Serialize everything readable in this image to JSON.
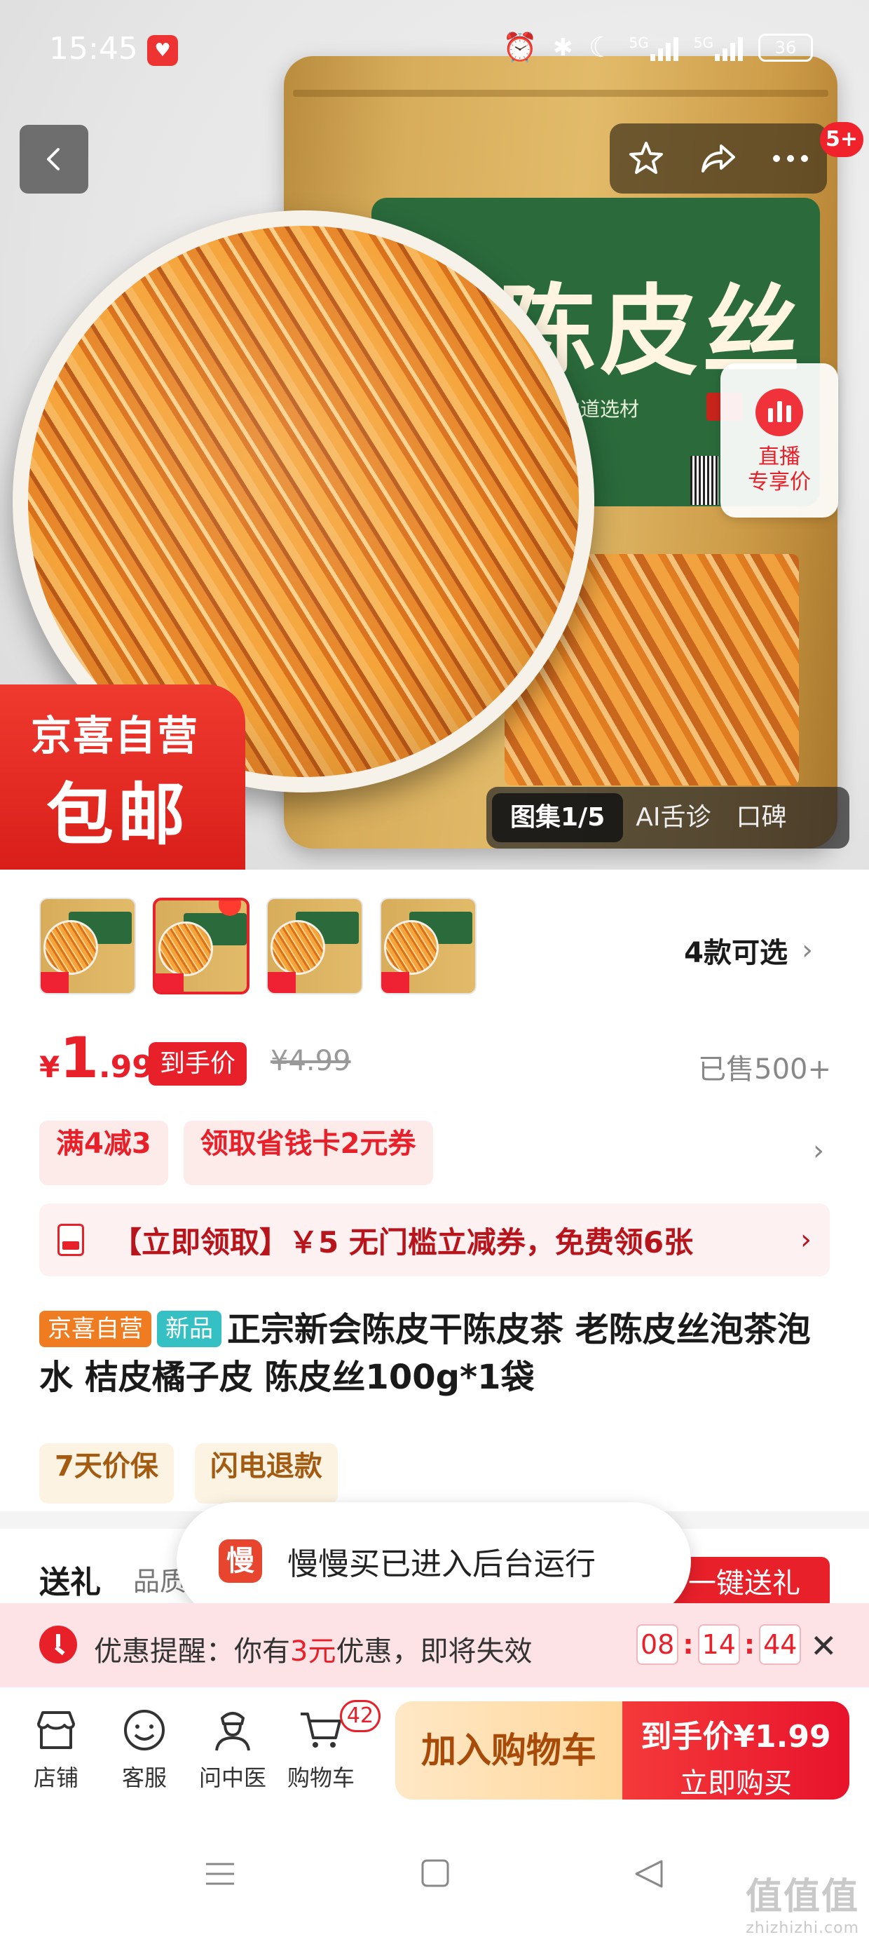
{
  "status_bar": {
    "time": "15:45",
    "network_1": "5G",
    "network_2": "5G",
    "battery": "36"
  },
  "header": {
    "notification_count": "5+"
  },
  "hero": {
    "bag_title": "陈皮丝",
    "bag_subtitle": "地道选材",
    "badge_line1": "京喜自营",
    "badge_line2": "包邮",
    "live_label_line1": "直播",
    "live_label_line2": "专享价",
    "gallery_tabs": [
      {
        "label": "图集1/5",
        "active": true
      },
      {
        "label": "AI舌诊",
        "active": false
      },
      {
        "label": "口碑",
        "active": false
      }
    ]
  },
  "variants": {
    "count_label": "4款可选"
  },
  "price": {
    "currency": "¥",
    "integer": "1",
    "decimal": ".99",
    "badge": "到手价",
    "original": "¥4.99",
    "sold": "已售500+"
  },
  "promos": {
    "tags": [
      "满4减3",
      "领取省钱卡2元券"
    ]
  },
  "coupon": {
    "text": "【立即领取】￥5 无门槛立减券，免费领6张"
  },
  "product": {
    "tag_store": "京喜自营",
    "tag_new": "新品",
    "title": "正宗新会陈皮干陈皮茶 老陈皮丝泡茶泡水 桔皮橘子皮 陈皮丝100g*1袋"
  },
  "services": [
    "7天价保",
    "闪电退款"
  ],
  "gift": {
    "title": "送礼",
    "subtitle": "品质",
    "button": "一键送礼"
  },
  "toast": {
    "icon_char": "慢",
    "text": "慢慢买已进入后台运行"
  },
  "reminder": {
    "prefix": "优惠提醒：你有",
    "amount": "3元",
    "suffix": "优惠，即将失效",
    "hours": "08",
    "minutes": "14",
    "seconds": "44"
  },
  "action_bar": {
    "nav": [
      {
        "label": "店铺",
        "icon": "shop-icon"
      },
      {
        "label": "客服",
        "icon": "customer-service-icon"
      },
      {
        "label": "问中医",
        "icon": "doctor-icon"
      },
      {
        "label": "购物车",
        "icon": "cart-icon"
      }
    ],
    "cart_count": "42",
    "add_to_cart": "加入购物车",
    "buy_price": "到手价¥1.99",
    "buy_now": "立即购买"
  },
  "watermark": {
    "text": "值值值",
    "url": "zhizhizhi.com"
  },
  "colors": {
    "brand_red": "#e8202a",
    "cart_button_bg": "#ffd79c",
    "toast_icon": "#e8452e"
  }
}
